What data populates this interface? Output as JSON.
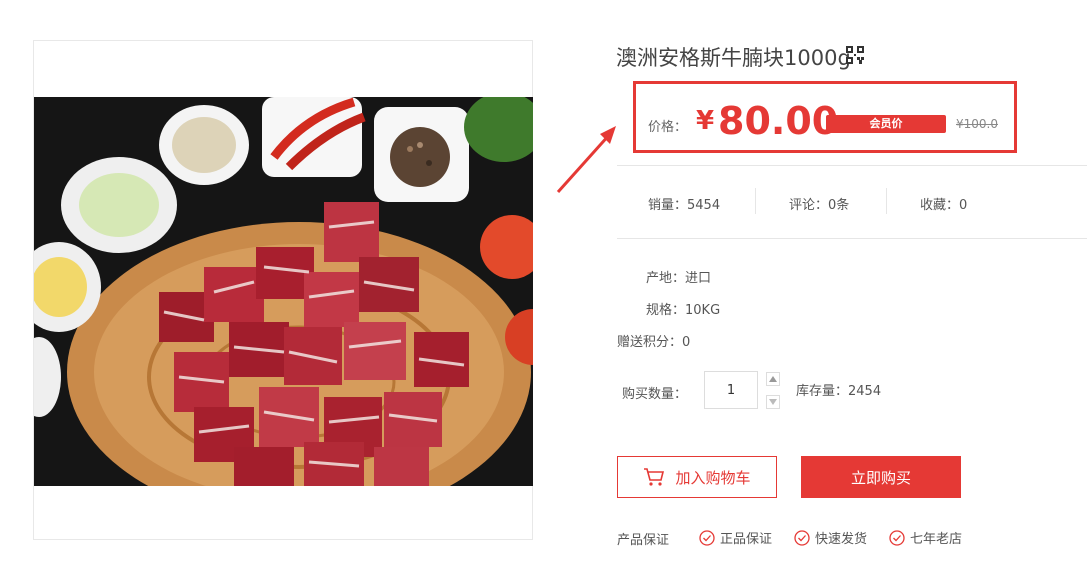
{
  "product": {
    "title": "澳洲安格斯牛腩块1000g",
    "image_alt": "diced beef"
  },
  "price": {
    "label": "价格：",
    "currency": "¥",
    "current": "80.00",
    "member_badge": "会员价",
    "original": "¥100.0"
  },
  "stats": {
    "sales": "销量：5454",
    "reviews": "评论：0条",
    "favorites": "收藏：0"
  },
  "specs": {
    "origin": "产地：进口",
    "size": "规格：10KG",
    "points": "赠送积分：0"
  },
  "purchase": {
    "qty_label": "购买数量：",
    "qty_value": "1",
    "stock": "库存量：2454",
    "add_cart": "加入购物车",
    "buy_now": "立即购买"
  },
  "guarantee": {
    "label": "产品保证",
    "items": [
      "正品保证",
      "快速发货",
      "七年老店"
    ]
  },
  "colors": {
    "accent": "#e53935",
    "text": "#555555",
    "border": "#e6e6e6"
  },
  "icons": [
    "qr-code-icon",
    "cart-icon",
    "check-circle-icon",
    "caret-up-icon",
    "caret-down-icon",
    "arrow-annotation"
  ]
}
